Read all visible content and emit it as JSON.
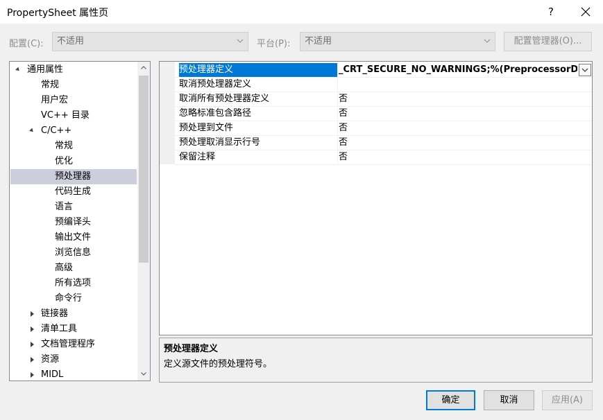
{
  "window": {
    "title": "PropertySheet 属性页",
    "help_label": "?",
    "close_icon": "close-icon"
  },
  "toolbar": {
    "config_label": "配置(C):",
    "config_value": "不适用",
    "platform_label": "平台(P):",
    "platform_value": "不适用",
    "config_manager_label": "配置管理器(O)..."
  },
  "tree": {
    "items": [
      {
        "label": "通用属性",
        "level": 0,
        "state": "expanded"
      },
      {
        "label": "常规",
        "level": 1,
        "state": "leaf"
      },
      {
        "label": "用户宏",
        "level": 1,
        "state": "leaf"
      },
      {
        "label": "VC++ 目录",
        "level": 1,
        "state": "leaf"
      },
      {
        "label": "C/C++",
        "level": 1,
        "state": "expanded"
      },
      {
        "label": "常规",
        "level": 2,
        "state": "leaf"
      },
      {
        "label": "优化",
        "level": 2,
        "state": "leaf"
      },
      {
        "label": "预处理器",
        "level": 2,
        "state": "leaf",
        "selected": true
      },
      {
        "label": "代码生成",
        "level": 2,
        "state": "leaf"
      },
      {
        "label": "语言",
        "level": 2,
        "state": "leaf"
      },
      {
        "label": "预编译头",
        "level": 2,
        "state": "leaf"
      },
      {
        "label": "输出文件",
        "level": 2,
        "state": "leaf"
      },
      {
        "label": "浏览信息",
        "level": 2,
        "state": "leaf"
      },
      {
        "label": "高级",
        "level": 2,
        "state": "leaf"
      },
      {
        "label": "所有选项",
        "level": 2,
        "state": "leaf"
      },
      {
        "label": "命令行",
        "level": 2,
        "state": "leaf"
      },
      {
        "label": "链接器",
        "level": 1,
        "state": "collapsed"
      },
      {
        "label": "清单工具",
        "level": 1,
        "state": "collapsed"
      },
      {
        "label": "文档管理程序",
        "level": 1,
        "state": "collapsed"
      },
      {
        "label": "资源",
        "level": 1,
        "state": "collapsed"
      },
      {
        "label": "MIDL",
        "level": 1,
        "state": "collapsed"
      }
    ]
  },
  "grid": {
    "rows": [
      {
        "name": "预处理器定义",
        "value": "_CRT_SECURE_NO_WARNINGS;%(PreprocessorDe",
        "selected": true,
        "bold": true
      },
      {
        "name": "取消预处理器定义",
        "value": ""
      },
      {
        "name": "取消所有预处理器定义",
        "value": "否"
      },
      {
        "name": "忽略标准包含路径",
        "value": "否"
      },
      {
        "name": "预处理到文件",
        "value": "否"
      },
      {
        "name": "预处理取消显示行号",
        "value": "否"
      },
      {
        "name": "保留注释",
        "value": "否"
      }
    ]
  },
  "description": {
    "title": "预处理器定义",
    "text": "定义源文件的预处理符号。"
  },
  "buttons": {
    "ok": "确定",
    "cancel": "取消",
    "apply": "应用(A)"
  },
  "colors": {
    "accent": "#0078d7",
    "tree_selection": "#cccedb"
  }
}
